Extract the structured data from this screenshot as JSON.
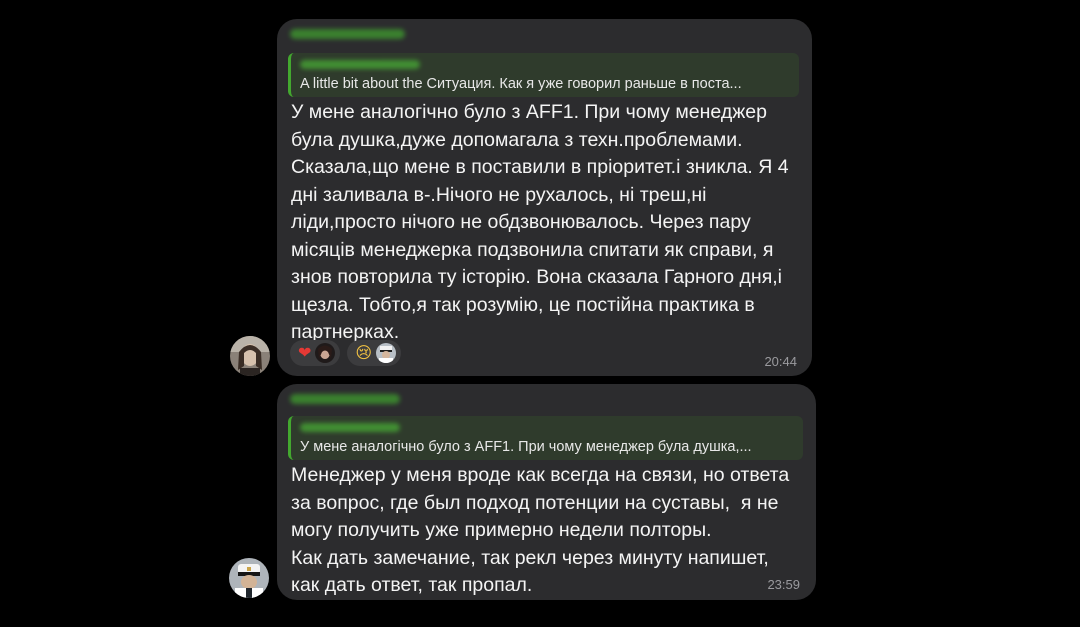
{
  "messages": [
    {
      "reply_text": "A little bit about the Ситуация.  Как я уже говорил раньше в поста...",
      "body": "У мене аналогічно було з AFF1. При чому менеджер\nбула душка,дуже допомагала з техн.проблемами.\nСказала,що мене в поставили в пріоритет.і зникла. Я 4\nдні заливала в-.Нічого не рухалось, ні треш,ні\nліди,просто нічого не обдзвонювалось. Через пару\nмісяців менеджерка подзвонила спитати як справи, я\nзнов повторила ту історію. Вона сказала Гарного дня,і\nщезла. Тобто,я так розумію, це постійна практика в\nпартнерках.",
      "time": "20:44",
      "reactions": [
        {
          "emoji": "❤",
          "icon": "heart-icon",
          "color": "#e53935"
        },
        {
          "emoji": "😢",
          "icon": "crying-face-icon",
          "color": "#f5c542"
        }
      ]
    },
    {
      "reply_text": "У мене аналогічно було з AFF1. При чому менеджер була душка,...",
      "body": "Менеджер у меня вроде как всегда на связи, но ответа\nза вопрос, где был подход потенции на суставы,  я не\nмогу получить уже примерно недели полторы.\nКак дать замечание, так рекл через минуту напишет,\nкак дать ответ, так пропал.",
      "time": "23:59"
    }
  ],
  "colors": {
    "background": "#000000",
    "bubble": "#2c2c2e",
    "sender_name": "#4cae35",
    "reply_bar": "#43a82f",
    "time": "#9a9a9e"
  }
}
